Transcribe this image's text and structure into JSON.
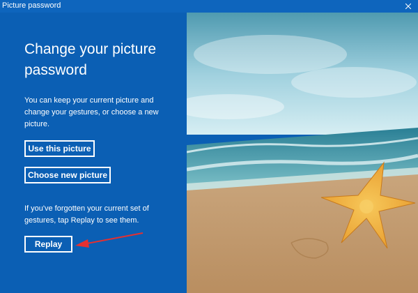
{
  "window": {
    "title": "Picture password",
    "close_icon": "close-icon"
  },
  "panel": {
    "heading": "Change your picture password",
    "description": "You can keep your current picture and change your gestures, or choose a new picture.",
    "use_picture_label": "Use this picture",
    "choose_picture_label": "Choose new picture",
    "hint": "If you've forgotten your current set of gestures, tap Replay to see them.",
    "replay_label": "Replay"
  },
  "picture": {
    "subject": "starfish-on-beach-image"
  },
  "colors": {
    "panel_background": "#0b5fb4",
    "annotation_arrow": "#e53030"
  }
}
